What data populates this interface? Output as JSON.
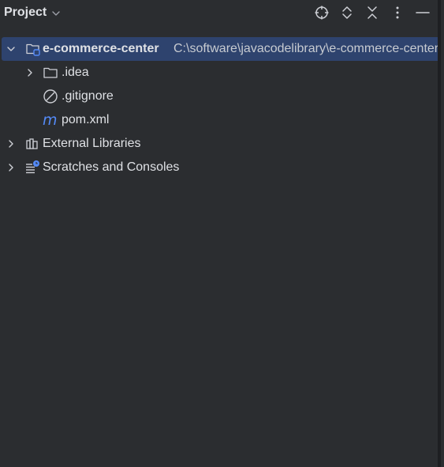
{
  "header": {
    "title": "Project",
    "icons": [
      "chevron-down-icon",
      "locate-icon",
      "expand-all-icon",
      "collapse-all-icon",
      "more-options-icon",
      "hide-icon"
    ]
  },
  "tree": {
    "root": {
      "name": "e-commerce-center",
      "path": "C:\\software\\javacodelibrary\\e-commerce-center",
      "icon": "module-folder-icon"
    },
    "children": [
      {
        "name": ".idea",
        "icon": "folder-icon"
      },
      {
        "name": ".gitignore",
        "icon": "ignored-file-icon"
      },
      {
        "name": "pom.xml",
        "icon": "maven-icon"
      }
    ],
    "external_libraries": {
      "name": "External Libraries",
      "icon": "libraries-icon"
    },
    "scratches": {
      "name": "Scratches and Consoles",
      "icon": "scratches-icon"
    }
  },
  "colors": {
    "background": "#2b2d30",
    "selection": "#2e436e",
    "text": "#dfe1e5",
    "accent_blue": "#548af7"
  }
}
